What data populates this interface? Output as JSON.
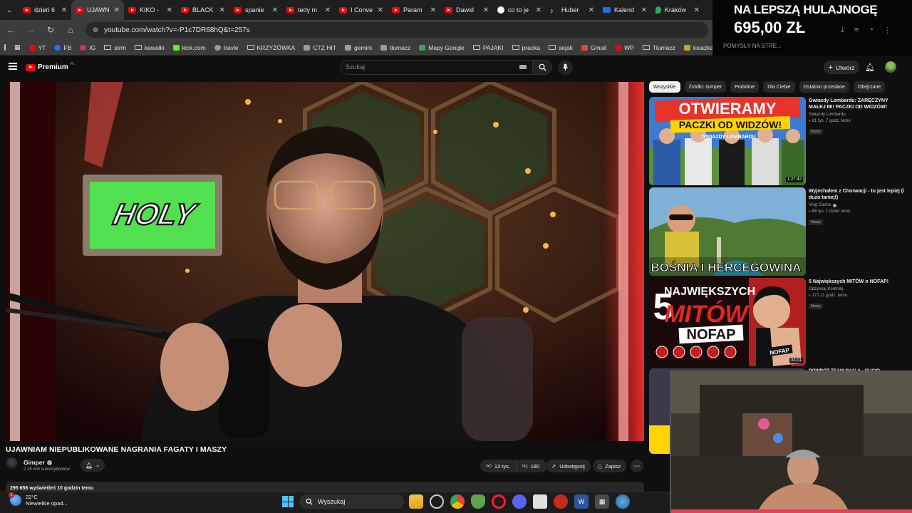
{
  "browser": {
    "tabs": [
      {
        "title": "dzień 6",
        "icon": "youtube-icon"
      },
      {
        "title": "UJAWN",
        "icon": "youtube-icon",
        "active": true
      },
      {
        "title": "KIKO -",
        "icon": "youtube-icon"
      },
      {
        "title": "BLACK",
        "icon": "youtube-icon"
      },
      {
        "title": "spanie",
        "icon": "youtube-icon"
      },
      {
        "title": "tedy m",
        "icon": "youtube-icon"
      },
      {
        "title": "I Conve",
        "icon": "youtube-icon"
      },
      {
        "title": "Param",
        "icon": "youtube-icon"
      },
      {
        "title": "Dawid",
        "icon": "youtube-icon"
      },
      {
        "title": "co to je",
        "icon": "google-icon"
      },
      {
        "title": "Huber",
        "icon": "tiktok-icon"
      },
      {
        "title": "Kalend",
        "icon": "calendar-icon"
      },
      {
        "title": "Kraków",
        "icon": "maps-icon"
      }
    ],
    "url": "youtube.com/watch?v=-P1c7DR68hQ&t=257s",
    "bookmarks": [
      {
        "label": "YT",
        "icon": "youtube-icon",
        "color": "#ff0000"
      },
      {
        "label": "FB",
        "icon": "facebook-icon",
        "color": "#1877f2"
      },
      {
        "label": "IG",
        "icon": "instagram-icon",
        "color": "#d62976"
      },
      {
        "label": "strm",
        "icon": "folder-icon"
      },
      {
        "label": "kawałki",
        "icon": "folder-icon"
      },
      {
        "label": "kick.com",
        "icon": "kick-icon",
        "color": "#53fc18"
      },
      {
        "label": "travle",
        "icon": "globe-icon"
      },
      {
        "label": "KRZYŻÓWKA",
        "icon": "folder-icon"
      },
      {
        "label": "CTZ HIT",
        "icon": "app-icon"
      },
      {
        "label": "gemini",
        "icon": "gemini-icon"
      },
      {
        "label": "tłumacz",
        "icon": "translate-icon"
      },
      {
        "label": "Mapy Google",
        "icon": "maps-icon",
        "color": "#34a853"
      },
      {
        "label": "PAJĄKI",
        "icon": "folder-icon"
      },
      {
        "label": "pracka",
        "icon": "folder-icon"
      },
      {
        "label": "sejak",
        "icon": "folder-icon"
      },
      {
        "label": "Gmail",
        "icon": "gmail-icon",
        "color": "#ea4335"
      },
      {
        "label": "WP",
        "icon": "wp-icon",
        "color": "#e30613"
      },
      {
        "label": "Tłumacz",
        "icon": "folder-icon"
      },
      {
        "label": "ksiazka",
        "icon": "book-icon",
        "color": "#c9a227"
      }
    ]
  },
  "overlay": {
    "line1": "NA LEPSZĄ HULAJNOGĘ",
    "line2": "695,00 ZŁ",
    "ghost_text": "POMYSŁY NA STRE..."
  },
  "youtube": {
    "logo": "Premium",
    "logo_suffix": "PL",
    "search_placeholder": "Szukaj",
    "create_label": "Utwórz",
    "video": {
      "title": "UJAWNIAM NIEPUBLIKOWANE NAGRANIA FAGATY I MASZY",
      "sign_text": "HOLY",
      "channel": "Gimper",
      "subscribers": "2,18 mln subskrybentów",
      "likes": "13 tys.",
      "dislikes": "180",
      "share_label": "Udostępnij",
      "save_label": "Zapisz",
      "views_line": "295 656 wyświetleń  10 godzin temu"
    },
    "chips": [
      "Wszystkie",
      "Źródło: Gimper",
      "Podobne",
      "Dla Ciebie",
      "Ostatnio przesłane",
      "Obejrzane"
    ],
    "recommendations": [
      {
        "title": "Gwiazdy Lombardu: ZARĘCZYNY MAŁEJ MI! PACZKI OD WIDZÓW!",
        "channel": "Gwiazdy Lombardu",
        "stats": "81 tys.  7 godz. temu",
        "badge": "Nowy",
        "duration": "1:27:42",
        "thumb_text_1": "OTWIERAMY",
        "thumb_text_2": "PACZKI OD WIDZÓW!",
        "thumb_sticker": "GWIAZDY LOMBARDU"
      },
      {
        "title": "Wyjechałem z Chorwacji - tu jest lepiej (i dużo taniej!)",
        "channel": "Vlog Casha",
        "stats": "88 tys.  1 dzień temu",
        "badge": "Nowy",
        "duration": "28:14",
        "thumb_text_1": "BOŚNIA I HERCEGOWINA"
      },
      {
        "title": "5 Największych MITÓW o NOFAP!",
        "channel": "Odzyskaj Kontrolę",
        "stats": "171  11 godz. temu",
        "badge": "Nowy",
        "duration": "33:01",
        "thumb_text_1": "5",
        "thumb_text_2": "NAJWIĘKSZYCH",
        "thumb_text_3": "MITÓW",
        "thumb_text_4": "NOFAP",
        "thumb_sign": "NOFAP"
      }
    ],
    "partial_title": "POWRÓT TEAM SKAI A - GUCIO"
  },
  "taskbar": {
    "temperature": "22°C",
    "weather_desc": "Niewielkie opad...",
    "weather_badge": "1",
    "search_label": "Wyszukaj"
  }
}
